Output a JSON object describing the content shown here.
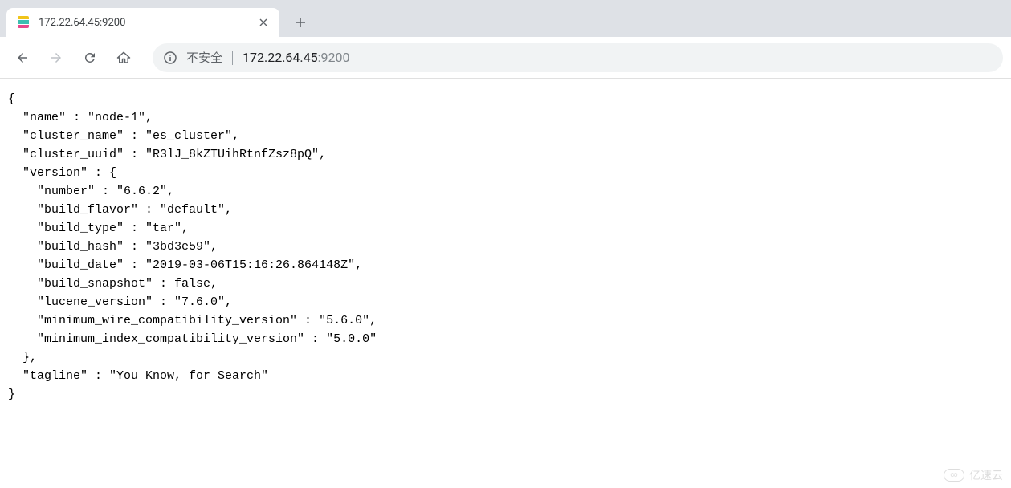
{
  "tab": {
    "title": "172.22.64.45:9200"
  },
  "address": {
    "security_label": "不安全",
    "host": "172.22.64.45",
    "port": ":9200"
  },
  "response": {
    "name": "node-1",
    "cluster_name": "es_cluster",
    "cluster_uuid": "R3lJ_8kZTUihRtnfZsz8pQ",
    "version": {
      "number": "6.6.2",
      "build_flavor": "default",
      "build_type": "tar",
      "build_hash": "3bd3e59",
      "build_date": "2019-03-06T15:16:26.864148Z",
      "build_snapshot": "false",
      "lucene_version": "7.6.0",
      "minimum_wire_compatibility_version": "5.6.0",
      "minimum_index_compatibility_version": "5.0.0"
    },
    "tagline": "You Know, for Search"
  },
  "watermark": {
    "text": "亿速云"
  }
}
